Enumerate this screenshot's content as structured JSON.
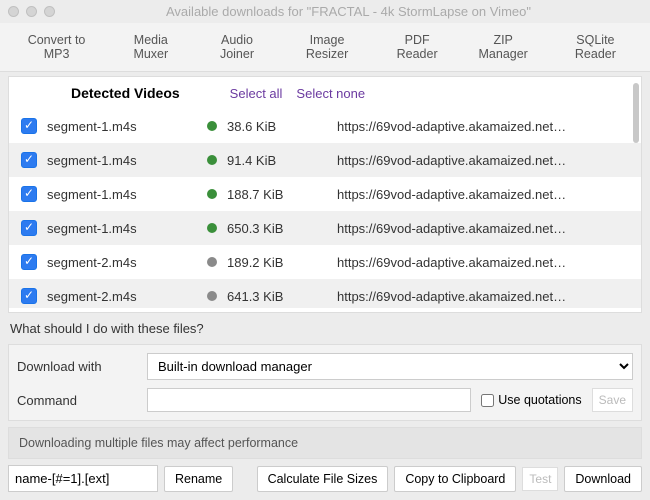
{
  "title": "Available downloads for \"FRACTAL - 4k StormLapse on Vimeo\"",
  "toolbar": [
    "Convert to MP3",
    "Media Muxer",
    "Audio Joiner",
    "Image Resizer",
    "PDF Reader",
    "ZIP Manager",
    "SQLite Reader"
  ],
  "header": {
    "title": "Detected Videos",
    "select_all": "Select all",
    "select_none": "Select none"
  },
  "rows": [
    {
      "checked": true,
      "name": "segment-1.m4s",
      "status": "green",
      "size": "38.6 KiB",
      "url": "https://69vod-adaptive.akamaized.net…"
    },
    {
      "checked": true,
      "name": "segment-1.m4s",
      "status": "green",
      "size": "91.4 KiB",
      "url": "https://69vod-adaptive.akamaized.net…"
    },
    {
      "checked": true,
      "name": "segment-1.m4s",
      "status": "green",
      "size": "188.7 KiB",
      "url": "https://69vod-adaptive.akamaized.net…"
    },
    {
      "checked": true,
      "name": "segment-1.m4s",
      "status": "green",
      "size": "650.3 KiB",
      "url": "https://69vod-adaptive.akamaized.net…"
    },
    {
      "checked": true,
      "name": "segment-2.m4s",
      "status": "gray",
      "size": "189.2 KiB",
      "url": "https://69vod-adaptive.akamaized.net…"
    },
    {
      "checked": true,
      "name": "segment-2.m4s",
      "status": "gray",
      "size": "641.3 KiB",
      "url": "https://69vod-adaptive.akamaized.net…"
    }
  ],
  "question": "What should I do with these files?",
  "panel": {
    "download_with_label": "Download with",
    "download_with_value": "Built-in download manager",
    "command_label": "Command",
    "command_value": "",
    "use_quotations": "Use quotations",
    "save": "Save"
  },
  "warning": "Downloading multiple files may affect performance",
  "bottom": {
    "pattern": "name-[#=1].[ext]",
    "rename": "Rename",
    "calc": "Calculate File Sizes",
    "copy": "Copy to Clipboard",
    "test": "Test",
    "download": "Download"
  }
}
